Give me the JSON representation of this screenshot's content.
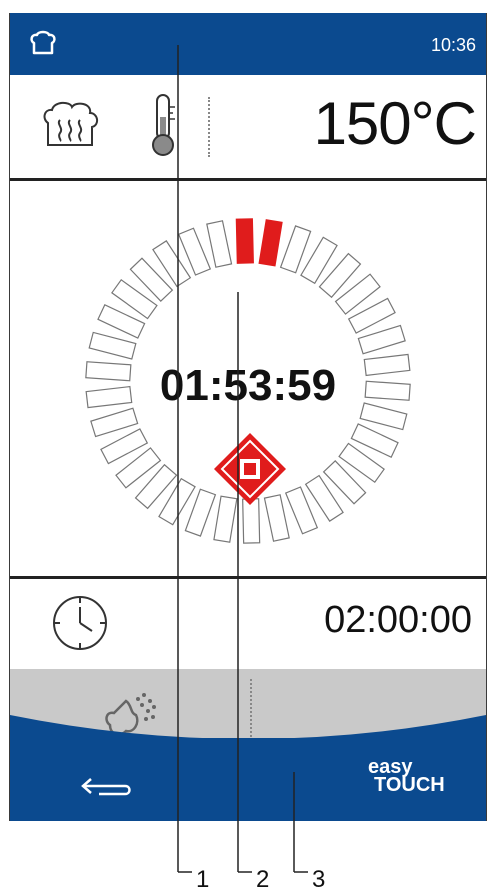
{
  "header": {
    "time": "10:36",
    "icon": "chef-hat-icon"
  },
  "temperature": {
    "value": "150°C",
    "icons": [
      "steam-icon",
      "thermometer-icon"
    ]
  },
  "stages": [
    "1",
    "2",
    "3"
  ],
  "dial": {
    "countdown": "01:53:59",
    "segments_total": 34,
    "segments_active": 2
  },
  "timer": {
    "set_time": "02:00:00",
    "icon": "clock-icon"
  },
  "steam": {
    "icon": "steam-spray-icon"
  },
  "footer": {
    "back_icon": "back-arrow-icon",
    "brand_line1": "easy",
    "brand_line2": "TOUCH"
  },
  "callouts": [
    "1",
    "2",
    "3"
  ],
  "colors": {
    "blue": "#0b4a8f",
    "red": "#e01c1c"
  }
}
